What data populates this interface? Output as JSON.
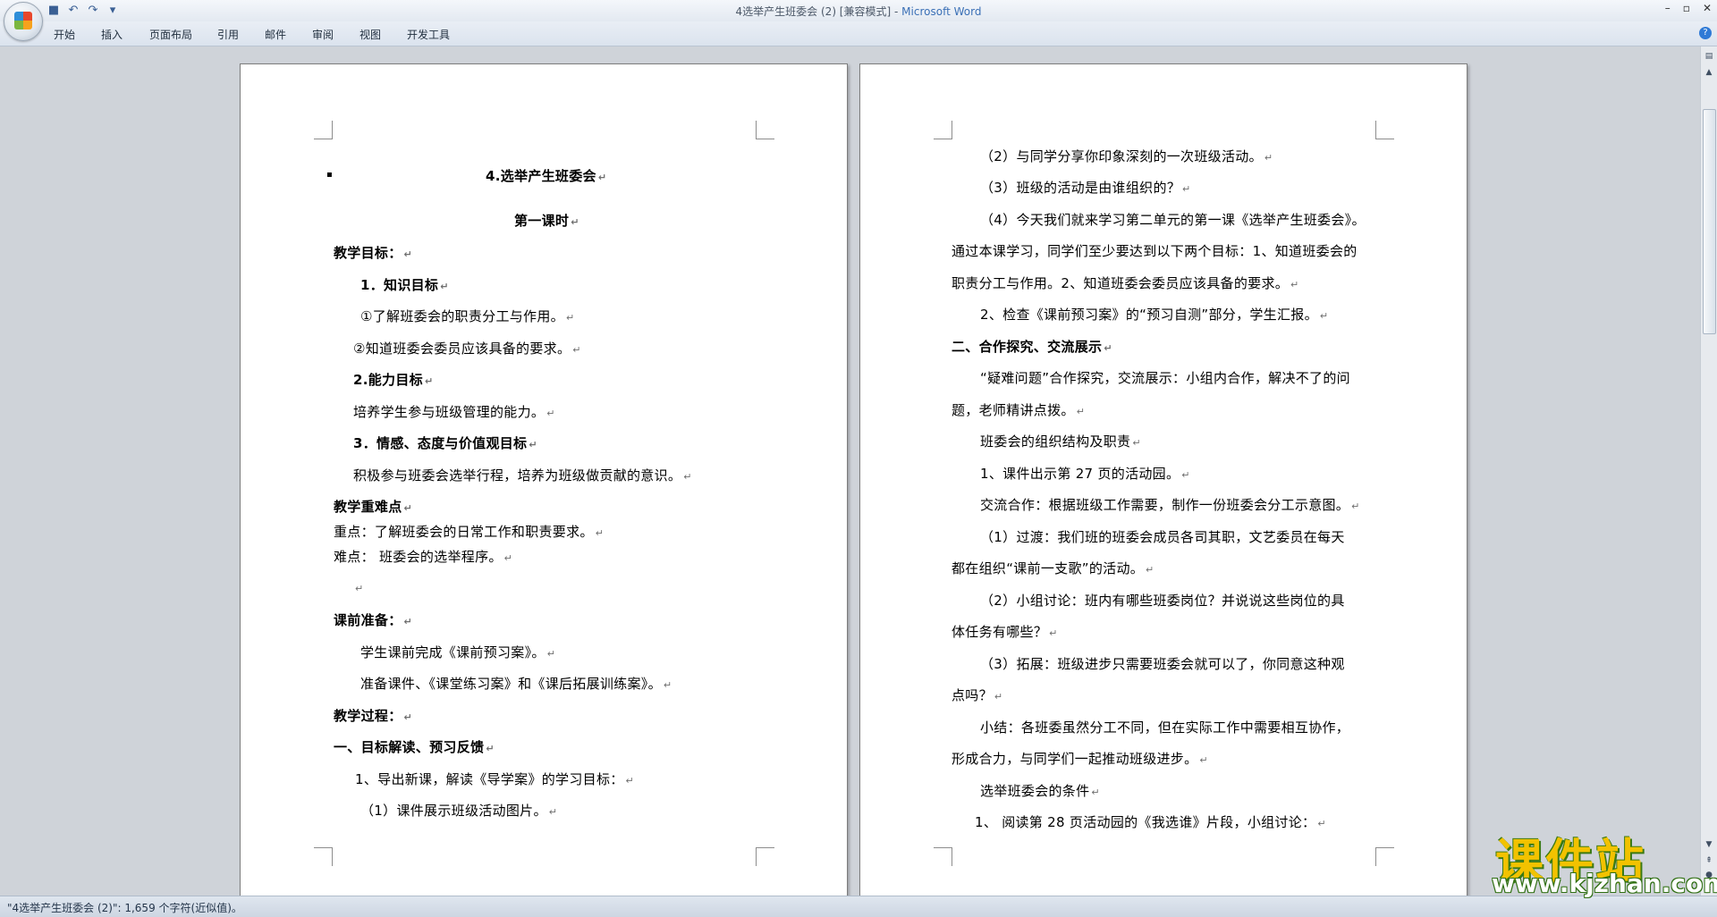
{
  "window": {
    "title_doc": "4选举产生班委会 (2) [兼容模式]",
    "title_app": "Microsoft Word"
  },
  "ribbon": {
    "tabs": [
      "开始",
      "插入",
      "页面布局",
      "引用",
      "邮件",
      "审阅",
      "视图",
      "开发工具"
    ]
  },
  "qat_icons": [
    "save-icon",
    "undo-icon",
    "redo-icon",
    "customize-icon"
  ],
  "page1": {
    "lines": [
      "4.选举产生班委会",
      "第一课时",
      "教学目标：",
      "1．知识目标",
      "①了解班委会的职责分工与作用。",
      "②知道班委会委员应该具备的要求。",
      "2.能力目标",
      "培养学生参与班级管理的能力。",
      "3．情感、态度与价值观目标",
      "积极参与班委会选举行程，培养为班级做贡献的意识。",
      "教学重难点",
      "重点：了解班委会的日常工作和职责要求。",
      "难点：  班委会的选举程序。",
      "",
      "课前准备：",
      "学生课前完成《课前预习案》。",
      "准备课件、《课堂练习案》和《课后拓展训练案》。",
      "教学过程：",
      "一、目标解读、预习反馈",
      "1、导出新课，解读《导学案》的学习目标：",
      "（1）课件展示班级活动图片。"
    ]
  },
  "page2": {
    "lines": [
      "（2）与同学分享你印象深刻的一次班级活动。",
      "（3）班级的活动是由谁组织的？",
      "（4）今天我们就来学习第二单元的第一课《选举产生班委会》。",
      "通过本课学习，同学们至少要达到以下两个目标：1、知道班委会的",
      "职责分工与作用。2、知道班委会委员应该具备的要求。",
      "2、检查《课前预习案》的“预习自测”部分，学生汇报。",
      "二、合作探究、交流展示",
      "“疑难问题”合作探究，交流展示：小组内合作，解决不了的问",
      "题，老师精讲点拨。",
      "班委会的组织结构及职责",
      "1、课件出示第 27 页的活动园。",
      "交流合作：根据班级工作需要，制作一份班委会分工示意图。",
      "（1）过渡：我们班的班委会成员各司其职，文艺委员在每天",
      "都在组织“课前一支歌”的活动。",
      "（2）小组讨论：班内有哪些班委岗位？并说说这些岗位的具",
      "体任务有哪些？",
      "（3）拓展：班级进步只需要班委会就可以了，你同意这种观",
      "点吗？",
      "小结：各班委虽然分工不同，但在实际工作中需要相互协作，",
      "形成合力，与同学们一起推动班级进步。",
      "选举班委会的条件",
      "1、     阅读第 28 页活动园的《我选谁》片段，小组讨论："
    ]
  },
  "paragraph_mark": "↵",
  "statusbar": {
    "text": "\"4选举产生班委会 (2)\": 1,659 个字符(近似值)。"
  },
  "watermark": {
    "brand": "课件站",
    "url": "www.kjzhan.com"
  }
}
